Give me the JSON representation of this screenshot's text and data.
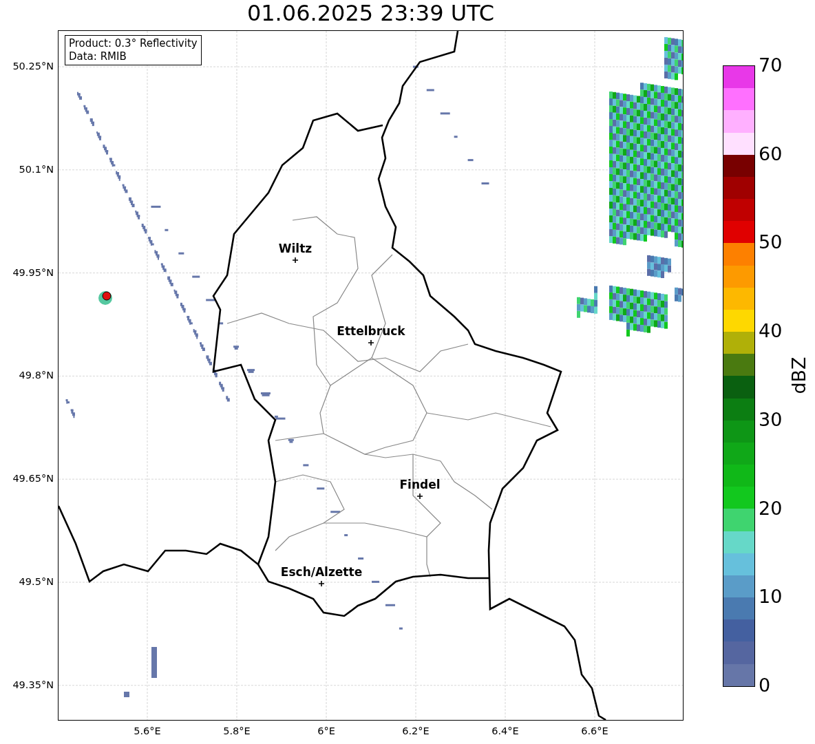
{
  "title": "01.06.2025 23:39 UTC",
  "info_box": {
    "lines": [
      "Product: 0.3° Reflectivity",
      "Data: RMIB"
    ]
  },
  "map": {
    "lat_labels": [
      "50.25°N",
      "50.1°N",
      "49.95°N",
      "49.8°N",
      "49.65°N",
      "49.5°N",
      "49.35°N"
    ],
    "lon_labels": [
      "5.6°E",
      "5.8°E",
      "6°E",
      "6.2°E",
      "6.4°E",
      "6.6°E"
    ],
    "cities": [
      {
        "name": "Wiltz"
      },
      {
        "name": "Ettelbruck"
      },
      {
        "name": "Findel"
      },
      {
        "name": "Esch/Alzette"
      }
    ]
  },
  "colorbar": {
    "label": "dBZ",
    "ticks": [
      "70",
      "60",
      "50",
      "40",
      "30",
      "20",
      "10",
      "0"
    ],
    "bands": [
      {
        "color": "#e838e8"
      },
      {
        "color": "#ff70ff"
      },
      {
        "color": "#ffb0ff"
      },
      {
        "color": "#ffe0ff"
      },
      {
        "color": "#780000"
      },
      {
        "color": "#a00000"
      },
      {
        "color": "#c00000"
      },
      {
        "color": "#e00000"
      },
      {
        "color": "#fd8000"
      },
      {
        "color": "#fd9a00"
      },
      {
        "color": "#fdb800"
      },
      {
        "color": "#fed800"
      },
      {
        "color": "#b0b008"
      },
      {
        "color": "#4a7a10"
      },
      {
        "color": "#0a6010"
      },
      {
        "color": "#0c7e12"
      },
      {
        "color": "#0e9616"
      },
      {
        "color": "#10a818"
      },
      {
        "color": "#10b818"
      },
      {
        "color": "#12c81e"
      },
      {
        "color": "#3fd46f"
      },
      {
        "color": "#66d8c8"
      },
      {
        "color": "#66c0dc"
      },
      {
        "color": "#5a9cc8"
      },
      {
        "color": "#4a7ab0"
      },
      {
        "color": "#4460a0"
      },
      {
        "color": "#5566a0"
      },
      {
        "color": "#6676a8"
      }
    ]
  }
}
